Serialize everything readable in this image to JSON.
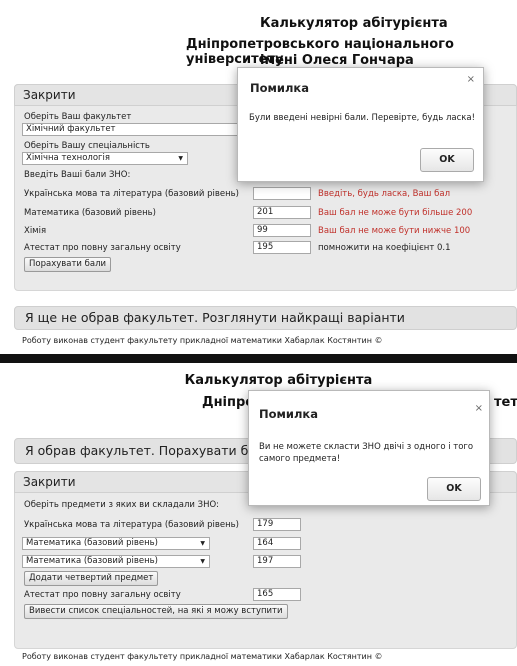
{
  "screen1": {
    "title_line1": "Калькулятор абітурієнта",
    "title_line2": "Дніпропетровського національного університету",
    "title_line3": "імені Олеся Гончара",
    "close_header": "Закрити",
    "faculty_label": "Оберіть Ваш факультет",
    "faculty_value": "Хімічний факультет",
    "specialty_label": "Оберіть Вашу спеціальність",
    "specialty_value": "Хімічна технологія",
    "scores_label": "Введіть Ваші бали ЗНО:",
    "rows": [
      {
        "label": "Українська мова та література (базовий рівень)",
        "value": "",
        "message": "Введіть, будь ласка, Ваш бал"
      },
      {
        "label": "Математика (базовий рівень)",
        "value": "201",
        "message": "Ваш бал не може бути більше 200"
      },
      {
        "label": "Хімія",
        "value": "99",
        "message": "Ваш бал не може бути нижче 100"
      }
    ],
    "certificate_label": "Атестат про повну загальну освіту",
    "certificate_value": "195",
    "certificate_hint": "помножити на коефіцієнт 0.1",
    "calc_button": "Порахувати бали",
    "not_chosen_bar": "Я ще не обрав факультет. Розглянути найкращі варіанти",
    "footer": "Роботу виконав студент факультету прикладної математики Хабарлак Костянтин ©",
    "dialog": {
      "title": "Помилка",
      "close": "×",
      "message": "Були введені невірні бали. Перевірте, будь ласка!",
      "ok": "OK"
    }
  },
  "screen2": {
    "title_line1": "Калькулятор абітурієнта",
    "title_line2_left": "Дніпро",
    "title_line2_right": "тету",
    "chosen_bar": "Я обрав факультет. Порахувати балі",
    "close_header": "Закрити",
    "subjects_label": "Оберіть предмети з яких ви складали ЗНО:",
    "ukr_label": "Українська мова та література (базовий рівень)",
    "ukr_value": "179",
    "selects": [
      {
        "value": "Математика (базовий рівень)",
        "score": "164"
      },
      {
        "value": "Математика (базовий рівень)",
        "score": "197"
      }
    ],
    "add_button": "Додати четвертий предмет",
    "certificate_label": "Атестат про повну загальну освіту",
    "certificate_value": "165",
    "list_button": "Вивести список спеціальностей, на які я можу вступити",
    "footer": "Роботу виконав студент факультету прикладної математики Хабарлак Костянтин ©",
    "dialog": {
      "title": "Помилка",
      "close": "×",
      "message_line1": "Ви не можете скласти ЗНО двічі з одного і того",
      "message_line2": "самого предмета!",
      "ok": "OK"
    }
  },
  "colors": {
    "error_text": "#c0302a",
    "panel_bg": "#eaeaea",
    "separator": "#111111"
  },
  "icons": {
    "select_arrow": "▼",
    "close": "×"
  }
}
